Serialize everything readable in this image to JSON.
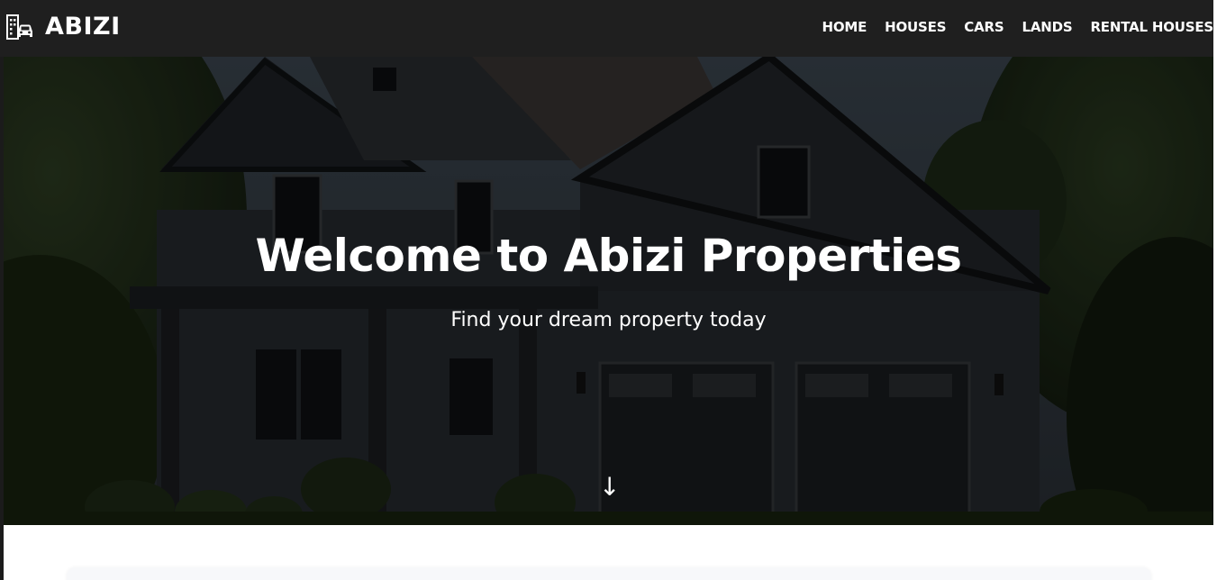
{
  "brand": {
    "name": "ABIZI",
    "icon": "building-car-icon"
  },
  "nav": {
    "items": [
      {
        "label": "HOME"
      },
      {
        "label": "HOUSES"
      },
      {
        "label": "CARS"
      },
      {
        "label": "LANDS"
      },
      {
        "label": "RENTAL HOUSES"
      }
    ]
  },
  "hero": {
    "title": "Welcome to Abizi Properties",
    "subtitle": "Find your dream property today",
    "scroll_icon": "arrow-down-icon",
    "scroll_glyph": "↓"
  },
  "colors": {
    "navbar_bg": "#1f1f1f",
    "text": "#ffffff",
    "page_bg": "#ffffff"
  }
}
